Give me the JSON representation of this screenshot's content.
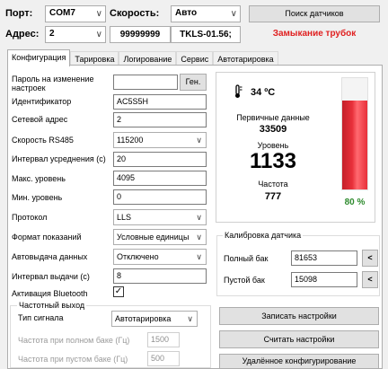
{
  "top": {
    "port_label": "Порт:",
    "port_value": "COM7",
    "speed_label": "Скорость:",
    "speed_value": "Авто",
    "search_button": "Поиск датчиков",
    "address_label": "Адрес:",
    "address_value": "2",
    "serial_value": "99999999",
    "model_value": "TKLS-01.56;",
    "status_text": "Замыкание трубок",
    "status_color": "#e02020"
  },
  "tabs": [
    "Конфигурация",
    "Тарировка",
    "Логирование",
    "Сервис",
    "Автотарировка"
  ],
  "config": {
    "password_label": "Пароль на изменение настроек",
    "password_value": "",
    "gen_button": "Ген.",
    "id_label": "Идентификатор",
    "id_value": "AC5S5H",
    "net_addr_label": "Сетевой адрес",
    "net_addr_value": "2",
    "rs485_label": "Скорость RS485",
    "rs485_value": "115200",
    "avg_label": "Интервал усреднения (с)",
    "avg_value": "20",
    "max_label": "Макс. уровень",
    "max_value": "4095",
    "min_label": "Мин. уровень",
    "min_value": "0",
    "protocol_label": "Протокол",
    "protocol_value": "LLS",
    "format_label": "Формат показаний",
    "format_value": "Условные единицы",
    "auto_label": "Автовыдача данных",
    "auto_value": "Отключено",
    "interval_label": "Интервал выдачи (с)",
    "interval_value": "8",
    "bt_label": "Активация Bluetooth",
    "bt_checked": true
  },
  "freq": {
    "group_title": "Частотный выход",
    "signal_label": "Тип сигнала",
    "signal_value": "Автотарировка",
    "full_label": "Частота при полном баке (Гц)",
    "full_value": "1500",
    "empty_label": "Частота при пустом баке (Гц)",
    "empty_value": "500"
  },
  "status": {
    "temperature": "34 ºC",
    "primary_label": "Первичные данные",
    "primary_value": "33509",
    "level_label": "Уровень",
    "level_value": "1133",
    "freq_label": "Частота",
    "freq_value": "777",
    "percent_text": "80 %",
    "percent_fill": 0.8,
    "bar_color": "#e8303a"
  },
  "calib": {
    "title": "Калибровка датчика",
    "full_label": "Полный бак",
    "full_value": "81653",
    "empty_label": "Пустой бак",
    "empty_value": "15098",
    "set_btn": "<"
  },
  "actions": {
    "write": "Записать настройки",
    "read": "Считать настройки",
    "remote": "Удалённое конфигурирование"
  }
}
